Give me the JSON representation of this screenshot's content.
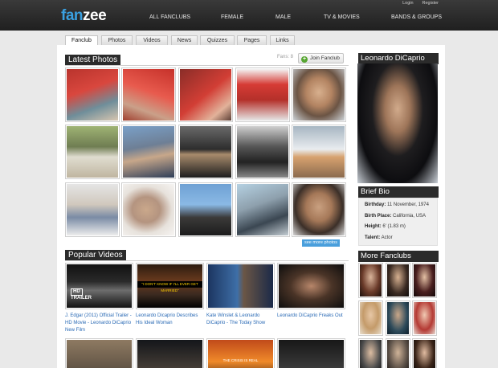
{
  "site": {
    "logo_a": "fan",
    "logo_b": "zee"
  },
  "auth": {
    "login": "Login",
    "register": "Register"
  },
  "nav": [
    {
      "label": "ALL FANCLUBS"
    },
    {
      "label": "FEMALE"
    },
    {
      "label": "MALE"
    },
    {
      "label": "TV & MOVIES"
    },
    {
      "label": "BANDS & GROUPS"
    }
  ],
  "tabs": [
    {
      "label": "Fanclub",
      "active": true
    },
    {
      "label": "Photos"
    },
    {
      "label": "Videos"
    },
    {
      "label": "News"
    },
    {
      "label": "Quizzes"
    },
    {
      "label": "Pages"
    },
    {
      "label": "Links"
    }
  ],
  "photos": {
    "title": "Latest Photos",
    "fans": "Fans: 8",
    "join_label": "Join Fanclub",
    "more_label": "see more photos",
    "images": [
      "g-red",
      "g-red2",
      "g-red3",
      "g-red4",
      "g-face",
      "g-tree",
      "g-denim",
      "g-dark",
      "g-bw",
      "g-jet",
      "g-chair",
      "g-pillow",
      "g-rock",
      "g-piano",
      "g-face2"
    ]
  },
  "videos": {
    "title": "Popular Videos",
    "items": [
      {
        "caption": "J. Edgar (2011) Official Trailer - HD Movie - Leonardo DiCaprio New Film",
        "image": "g-v1",
        "badge_hd": "HD",
        "badge_text": "TRAILER"
      },
      {
        "caption": "Leonardo Dicaprio Describes His Ideal Woman",
        "image": "g-v2",
        "overlay": "\"I DON'T KNOW IF I'LL EVER GET MARRIED\""
      },
      {
        "caption": "Kate Winslet & Leonardo DiCaprio - The Today Show",
        "image": "g-v3"
      },
      {
        "caption": "Leonardo DiCaprio Freaks Out",
        "image": "g-v4"
      }
    ],
    "row2": [
      "g-v5",
      "g-v6",
      "g-v7",
      "g-v8"
    ],
    "row2_overlay": "THE CRISIS IS REAL"
  },
  "profile": {
    "name": "Leonardo DiCaprio",
    "bio_title": "Brief Bio",
    "bio": [
      {
        "label": "Birthday:",
        "value": "11 November, 1974"
      },
      {
        "label": "Birth Place:",
        "value": "California, USA"
      },
      {
        "label": "Height:",
        "value": "6' (1.83 m)"
      },
      {
        "label": "Talent:",
        "value": "Actor"
      }
    ]
  },
  "more_fanclubs": {
    "title": "More Fanclubs",
    "images": [
      "g-f1",
      "g-f2",
      "g-f3",
      "g-f4",
      "g-f5",
      "g-f6",
      "g-f7",
      "g-f8",
      "g-f9"
    ]
  }
}
